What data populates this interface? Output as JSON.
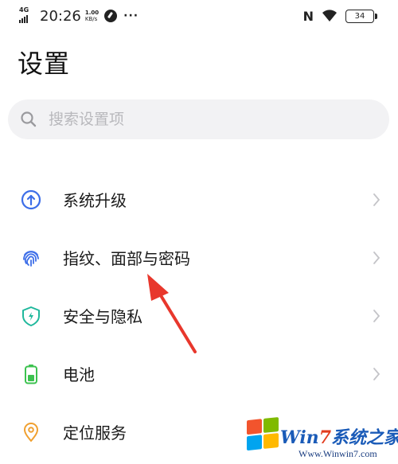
{
  "status_bar": {
    "network": "4G",
    "time": "20:26",
    "speed_value": "1.00",
    "speed_unit": "KB/s",
    "more": "···",
    "battery": "34"
  },
  "page": {
    "title": "设置"
  },
  "search": {
    "placeholder": "搜索设置项"
  },
  "items": [
    {
      "label": "系统升级",
      "icon": "upgrade-icon",
      "color": "#3d6ee8"
    },
    {
      "label": "指纹、面部与密码",
      "icon": "fingerprint-icon",
      "color": "#3d6ee8"
    },
    {
      "label": "安全与隐私",
      "icon": "shield-icon",
      "color": "#1fb89c"
    },
    {
      "label": "电池",
      "icon": "battery-icon",
      "color": "#3cc24f"
    },
    {
      "label": "定位服务",
      "icon": "location-icon",
      "color": "#f0a030"
    }
  ],
  "annotation": {
    "color": "#e8372c"
  },
  "watermark": {
    "brand_prefix": "Win",
    "brand_seven": "7",
    "brand_suffix": "系统之家",
    "url": "Www.Winwin7.com"
  }
}
